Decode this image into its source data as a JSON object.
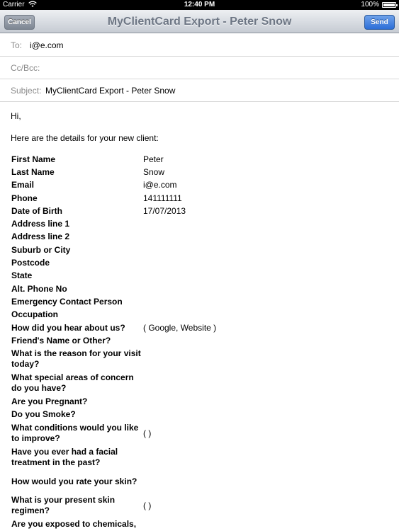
{
  "status_bar": {
    "carrier": "Carrier",
    "time": "12:40 PM",
    "battery": "100%",
    "battery_level": 1.0
  },
  "nav": {
    "title": "MyClientCard Export - Peter Snow",
    "cancel_label": "Cancel",
    "send_label": "Send"
  },
  "to": {
    "label": "To:",
    "value": "i@e.com"
  },
  "ccbcc": {
    "label": "Cc/Bcc:"
  },
  "subject": {
    "label": "Subject:",
    "value": "MyClientCard Export - Peter Snow"
  },
  "body": {
    "greeting": "Hi,",
    "intro": "Here are the details for your new client:",
    "rows": [
      {
        "k": "First Name",
        "v": "Peter"
      },
      {
        "k": "Last Name",
        "v": "Snow"
      },
      {
        "k": "Email",
        "v": "i@e.com"
      },
      {
        "k": "Phone",
        "v": "141111111"
      },
      {
        "k": "Date of Birth",
        "v": "17/07/2013"
      },
      {
        "k": "Address line 1",
        "v": ""
      },
      {
        "k": "Address line 2",
        "v": ""
      },
      {
        "k": "Suburb or City",
        "v": ""
      },
      {
        "k": "Postcode",
        "v": ""
      },
      {
        "k": "State",
        "v": ""
      },
      {
        "k": "Alt. Phone No",
        "v": ""
      },
      {
        "k": "Emergency Contact Person",
        "v": ""
      },
      {
        "k": "Occupation",
        "v": ""
      },
      {
        "k": "How did you hear about us?",
        "v": "( Google, Website )"
      },
      {
        "k": "Friend's Name or Other?",
        "v": ""
      },
      {
        "k": "What is the reason for your visit today?",
        "v": ""
      },
      {
        "k": "What special areas of concern do you have?",
        "v": ""
      },
      {
        "k": "Are you Pregnant?",
        "v": ""
      },
      {
        "k": "Do you Smoke?",
        "v": ""
      },
      {
        "k": "What conditions would you like to improve?",
        "v": "( )"
      },
      {
        "k": "Have you ever had a facial treatment in the past?",
        "v": ""
      },
      {
        "k": "How would you rate your skin?",
        "v": ""
      },
      {
        "k": "What is your present skin regimen?",
        "v": "( )"
      },
      {
        "k": "Are you exposed to chemicals, pollution, smoke, or other",
        "v": ""
      }
    ]
  }
}
